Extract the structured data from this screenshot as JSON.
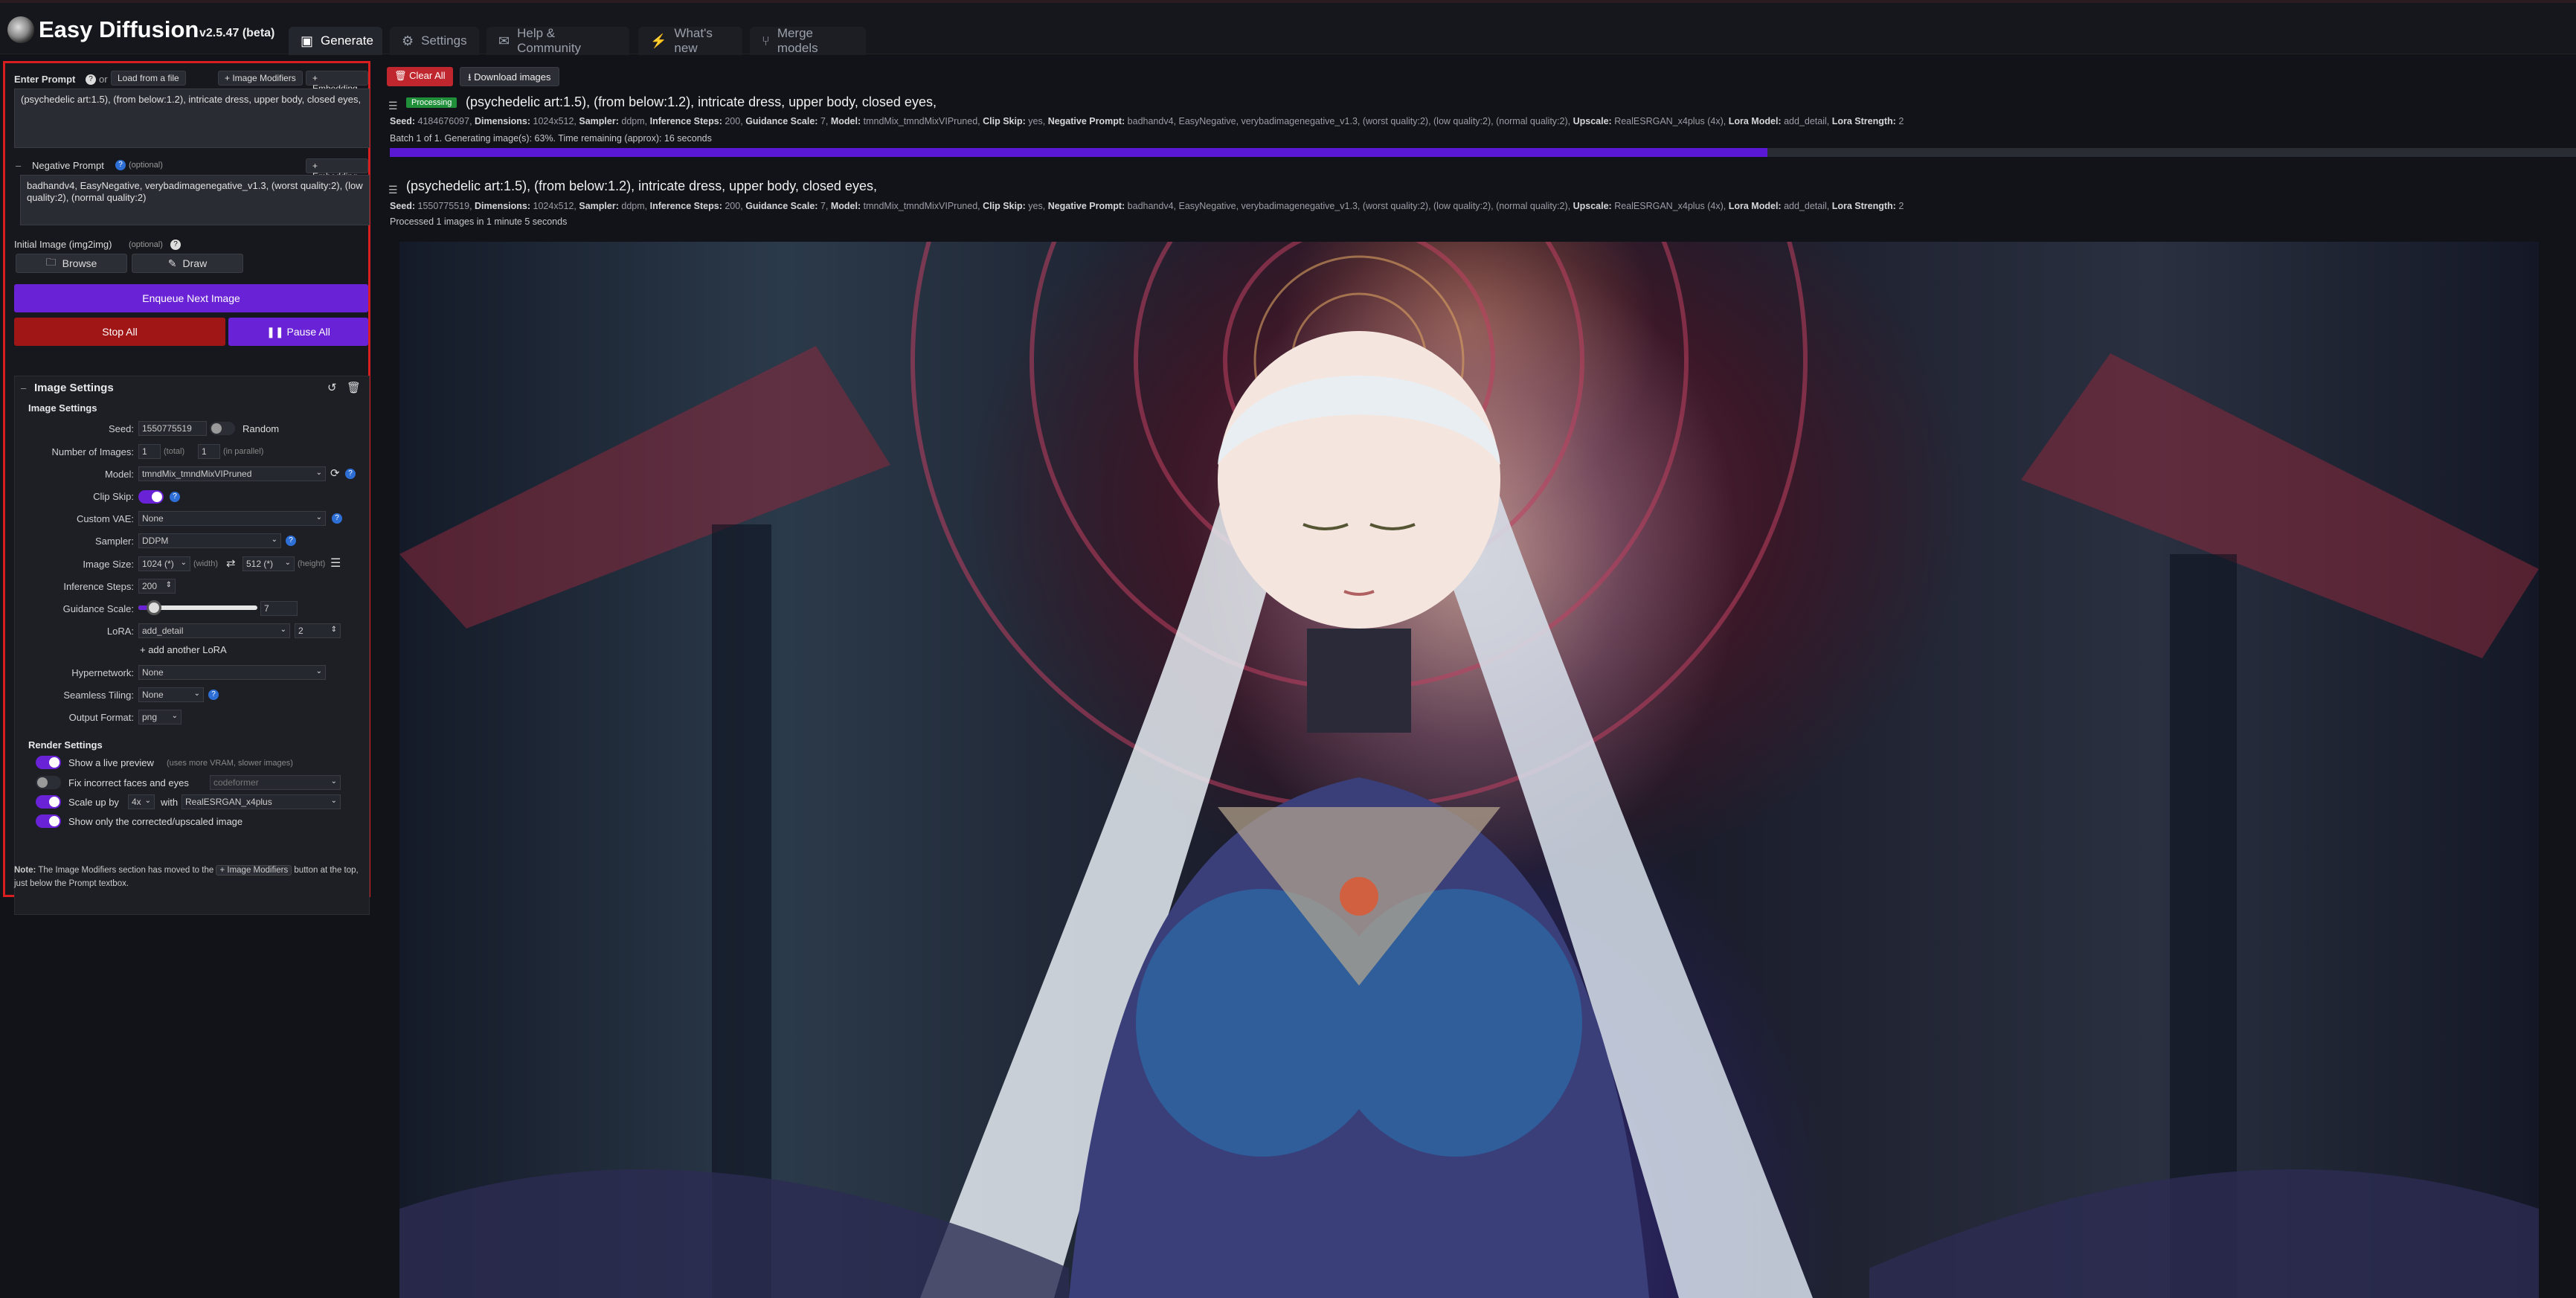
{
  "header": {
    "app_title": "Easy Diffusion",
    "app_version": "v2.5.47 (beta)",
    "tabs": [
      {
        "label": "Generate",
        "icon": "image-icon",
        "active": true
      },
      {
        "label": "Settings",
        "icon": "gear-icon",
        "active": false
      },
      {
        "label": "Help & Community",
        "icon": "comments-icon",
        "active": false
      },
      {
        "label": "What's new",
        "icon": "bolt-icon",
        "active": false
      },
      {
        "label": "Merge models",
        "icon": "merge-icon",
        "active": false
      }
    ]
  },
  "prompt": {
    "label": "Enter Prompt",
    "or_text": "or",
    "load_from_file": "Load from a file",
    "image_modifiers_btn": "+ Image Modifiers",
    "embedding_btn": "+ Embedding",
    "value": "(psychedelic art:1.5), (from below:1.2), intricate dress, upper body, closed eyes,",
    "negative_label": "Negative Prompt",
    "negative_optional": "(optional)",
    "negative_embedding_btn": "+ Embedding",
    "negative_value": "badhandv4, EasyNegative, verybadimagenegative_v1.3, (worst quality:2), (low quality:2), (normal quality:2)"
  },
  "initial_image": {
    "label": "Initial Image (img2img)",
    "optional": "(optional)",
    "browse": "Browse",
    "draw": "Draw"
  },
  "actions": {
    "enqueue": "Enqueue Next Image",
    "stop_all": "Stop All",
    "pause_all": "Pause All"
  },
  "image_settings": {
    "header": "Image Settings",
    "subheader": "Image Settings",
    "seed_label": "Seed:",
    "seed_value": "1550775519",
    "random_label": "Random",
    "num_images_label": "Number of Images:",
    "num_total": "1",
    "total_hint": "(total)",
    "num_parallel": "1",
    "parallel_hint": "(in parallel)",
    "model_label": "Model:",
    "model_value": "tmndMix_tmndMixVIPruned",
    "clip_skip_label": "Clip Skip:",
    "custom_vae_label": "Custom VAE:",
    "custom_vae_value": "None",
    "sampler_label": "Sampler:",
    "sampler_value": "DDPM",
    "image_size_label": "Image Size:",
    "width_value": "1024 (*)",
    "width_hint": "(width)",
    "height_value": "512 (*)",
    "height_hint": "(height)",
    "inference_steps_label": "Inference Steps:",
    "inference_steps_value": "200",
    "guidance_scale_label": "Guidance Scale:",
    "guidance_scale_value": "7",
    "guidance_scale_fraction": 0.13,
    "lora_label": "LoRA:",
    "lora_value": "add_detail",
    "lora_strength": "2",
    "add_lora": "+ add another LoRA",
    "hypernetwork_label": "Hypernetwork:",
    "hypernetwork_value": "None",
    "seamless_tiling_label": "Seamless Tiling:",
    "seamless_tiling_value": "None",
    "output_format_label": "Output Format:",
    "output_format_value": "png"
  },
  "render_settings": {
    "header": "Render Settings",
    "live_preview": "Show a live preview",
    "live_preview_hint": "(uses more VRAM, slower images)",
    "fix_faces": "Fix incorrect faces and eyes",
    "fix_faces_model": "codeformer",
    "scale_up": "Scale up by",
    "scale_factor": "4x",
    "with_text": "with",
    "upscaler": "RealESRGAN_x4plus",
    "show_only_corrected": "Show only the corrected/upscaled image"
  },
  "note": {
    "prefix": "Note:",
    "text1": "The Image Modifiers section has moved to the",
    "chip": "+ Image Modifiers",
    "text2": "button at the top, just below the Prompt textbox."
  },
  "toolbar": {
    "clear_all": "Clear All",
    "download_images": "Download images"
  },
  "tasks": [
    {
      "status": "Processing",
      "title": "(psychedelic art:1.5), (from below:1.2), intricate dress, upper body, closed eyes,",
      "seed": "4184676097",
      "progress_text": "Batch 1 of 1. Generating image(s): 63%. Time remaining (approx): 16 seconds",
      "progress": 0.63
    },
    {
      "title": "(psychedelic art:1.5), (from below:1.2), intricate dress, upper body, closed eyes,",
      "seed": "1550775519",
      "progress_text": "Processed 1 images in 1 minute 5 seconds"
    }
  ],
  "task_meta": {
    "seed_k": "Seed:",
    "dims_k": "Dimensions:",
    "dims_v": "1024x512,",
    "sampler_k": "Sampler:",
    "sampler_v": "ddpm,",
    "steps_k": "Inference Steps:",
    "steps_v": "200,",
    "guidance_k": "Guidance Scale:",
    "guidance_v": "7,",
    "model_k": "Model:",
    "model_v": "tmndMix_tmndMixVIPruned,",
    "clip_k": "Clip Skip:",
    "clip_v": "yes,",
    "neg_k": "Negative Prompt:",
    "neg_v": "badhandv4, EasyNegative, verybadimagenegative_v1.3, (worst quality:2), (low quality:2), (normal quality:2),",
    "upscale_k": "Upscale:",
    "upscale_v": "RealESRGAN_x4plus (4x),",
    "lora_k": "Lora Model:",
    "lora_v": "add_detail,",
    "lora_str_k": "Lora Strength:",
    "lora_str_v": "2"
  },
  "colors": {
    "accent_purple": "#6a22d6",
    "stop_red": "#a01616",
    "processing_green": "#1f8f3a",
    "clear_red": "#c0262d"
  }
}
